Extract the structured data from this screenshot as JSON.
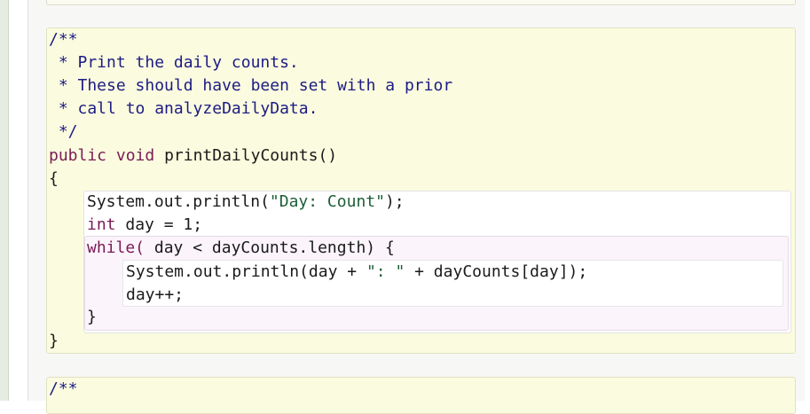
{
  "editor": {
    "comment_lines": [
      "/**",
      " * Print the daily counts.",
      " * These should have been set with a prior",
      " * call to analyzeDailyData.",
      " */"
    ],
    "signature": {
      "modifier": "public",
      "return_type": "void",
      "name": "printDailyCounts()"
    },
    "open_brace": "{",
    "stmt1": {
      "prefix": "System.out.println(",
      "string": "\"Day: Count\"",
      "suffix": ");"
    },
    "stmt2": {
      "keyword": "int",
      "rest": " day = 1;"
    },
    "while_header": {
      "keyword": "while(",
      "rest": " day < dayCounts.length) {"
    },
    "while_stmt1": {
      "prefix": "System.out.println(day + ",
      "string": "\": \"",
      "suffix": " + dayCounts[day]);"
    },
    "while_stmt2": "day++;",
    "while_close": "}",
    "close_brace": "}",
    "next_comment": "/**",
    "colors": {
      "comment": "#1c1c84",
      "keyword": "#7a1c55",
      "string": "#1d5e36",
      "method_background": "#fbfbdf",
      "while_background": "#fbf4fb"
    }
  }
}
